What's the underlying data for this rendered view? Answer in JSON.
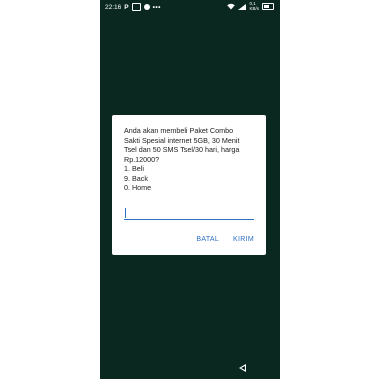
{
  "statusbar": {
    "time": "22:16",
    "app_icons": [
      "parking-icon",
      "box-icon",
      "messenger-icon"
    ],
    "more": "•••",
    "wifi_icon": "wifi-icon",
    "net_speed_top": "0,1",
    "net_speed_bottom": "KB/s",
    "battery_level": 40
  },
  "dialog": {
    "message": "Anda akan membeli Paket Combo\nSakti Spesial internet 5GB, 30 Menit\nTsel dan 50 SMS Tsel/30 hari, harga\nRp.12000?\n1. Beli\n9. Back\n0. Home",
    "input_value": "",
    "cancel_label": "BATAL",
    "send_label": "KIRIM"
  },
  "colors": {
    "background": "#0b2820",
    "accent": "#2d6fc4"
  }
}
